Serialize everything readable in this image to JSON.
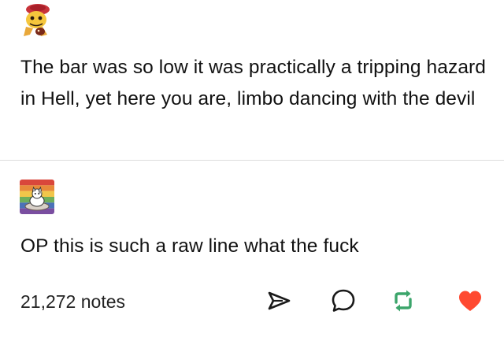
{
  "post": {
    "text": "The bar was so low it was practically a tripping hazard in Hell, yet here you are, limbo dancing with the devil"
  },
  "reply": {
    "text": "OP this is such a raw line what the fuck"
  },
  "footer": {
    "notes": "21,272 notes",
    "actions": [
      {
        "name": "share",
        "icon": "send-icon"
      },
      {
        "name": "reply",
        "icon": "speech-bubble-icon"
      },
      {
        "name": "reblog",
        "icon": "reblog-icon",
        "color": "#3ca56b"
      },
      {
        "name": "like",
        "icon": "heart-icon",
        "color": "#ff4930"
      }
    ]
  },
  "avatars": {
    "original_poster": "cartoon-character-avatar-icon",
    "replier": "cat-pride-flag-avatar-icon",
    "replier_flag_colors": [
      "#d9473b",
      "#e78a3a",
      "#f1c64a",
      "#6fae5b",
      "#4b72b8",
      "#7a4ea0"
    ]
  }
}
